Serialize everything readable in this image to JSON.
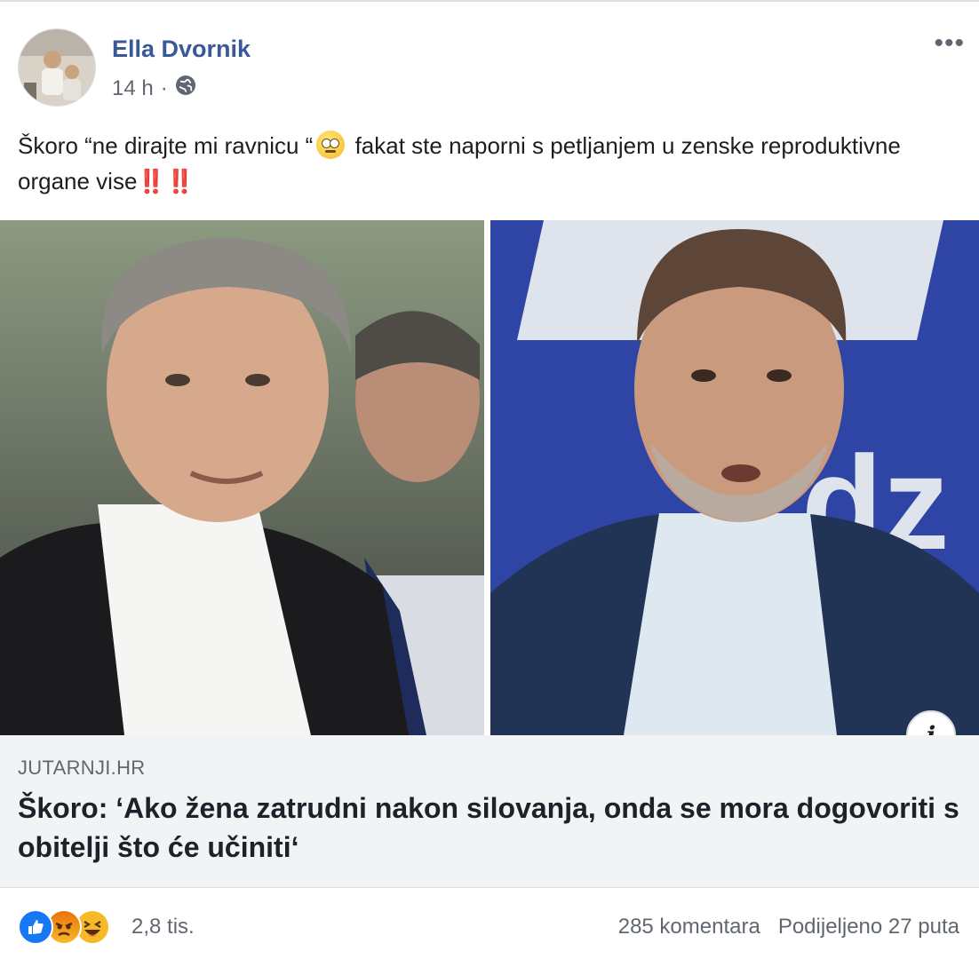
{
  "post": {
    "author": "Ella Dvornik",
    "time": "14 h",
    "separator": "·",
    "privacy_icon": "globe-icon",
    "more_icon": "more-options-icon",
    "text_part1": "Škoro “ne dirajte mi ravnicu “",
    "emoji": "rolling-eyes-emoji",
    "text_part2": " fakat ste naporni s petljanjem u zenske reproduktivne organe vise‼️‼️"
  },
  "link": {
    "domain": "JUTARNJI.HR",
    "headline": "Škoro: ‘Ako žena zatrudni nakon silovanja, onda se mora dogovoriti s obitelji što će učiniti‘"
  },
  "footer": {
    "reaction_icons": [
      "like-icon",
      "angry-icon",
      "haha-icon"
    ],
    "reaction_count": "2,8 tis.",
    "comments": "285 komentara",
    "shares": "Podijeljeno 27 puta"
  },
  "colors": {
    "author_link": "#385898",
    "meta_text": "#606770",
    "link_bg": "#f2f3f5",
    "like_blue": "#1877f2",
    "right_photo_bg": "#2a3f9c"
  }
}
